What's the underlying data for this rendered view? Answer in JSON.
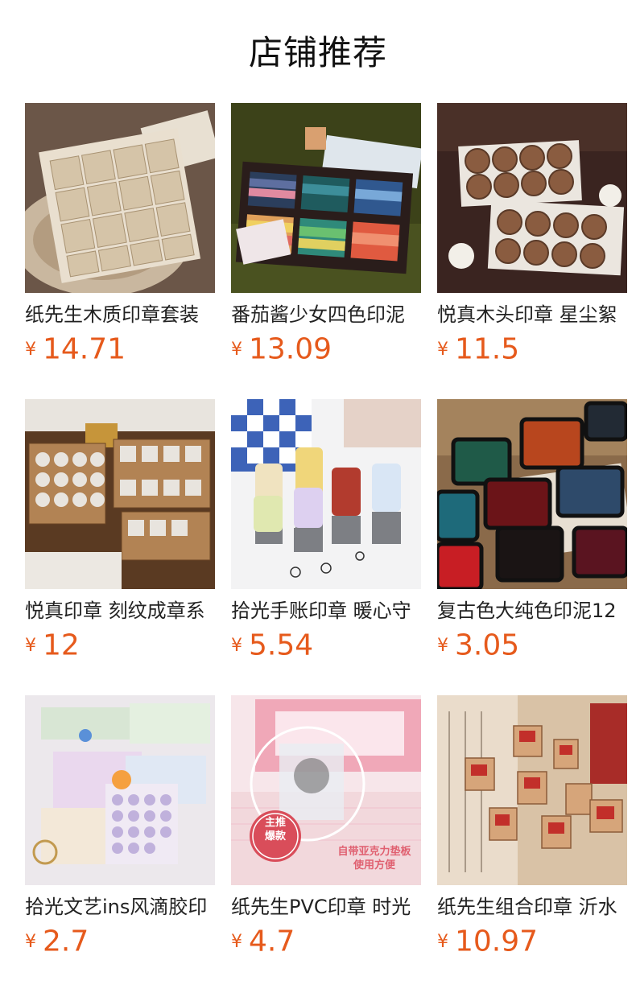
{
  "header": {
    "title": "店铺推荐"
  },
  "currency_symbol": "¥",
  "products": [
    {
      "name": "纸先生木质印章套装",
      "price": "14.71",
      "thumb_icon": "wooden-stamp-set-image"
    },
    {
      "name": "番茄酱少女四色印泥",
      "price": "13.09",
      "thumb_icon": "four-color-ink-pad-image"
    },
    {
      "name": "悦真木头印章 星尘絮",
      "price": "11.5",
      "thumb_icon": "round-wooden-stamps-image"
    },
    {
      "name": "悦真印章 刻纹成章系",
      "price": "12",
      "thumb_icon": "carved-stamp-collection-image"
    },
    {
      "name": "拾光手账印章 暖心守",
      "price": "5.54",
      "thumb_icon": "journal-roller-stamps-image"
    },
    {
      "name": "复古色大纯色印泥12",
      "price": "3.05",
      "thumb_icon": "vintage-ink-pads-image"
    },
    {
      "name": "拾光文艺ins风滴胶印",
      "price": "2.7",
      "thumb_icon": "clear-epoxy-stamps-image"
    },
    {
      "name": "纸先生PVC印章 时光",
      "price": "4.7",
      "thumb_icon": "pvc-stamp-with-block-image"
    },
    {
      "name": "纸先生组合印章 沂水",
      "price": "10.97",
      "thumb_icon": "chinese-seal-stamps-image"
    }
  ],
  "overlay_text": {
    "badge_line1": "主推",
    "badge_line2": "爆款",
    "caption_line1": "自带亚克力垫板",
    "caption_line2": "使用方便"
  }
}
